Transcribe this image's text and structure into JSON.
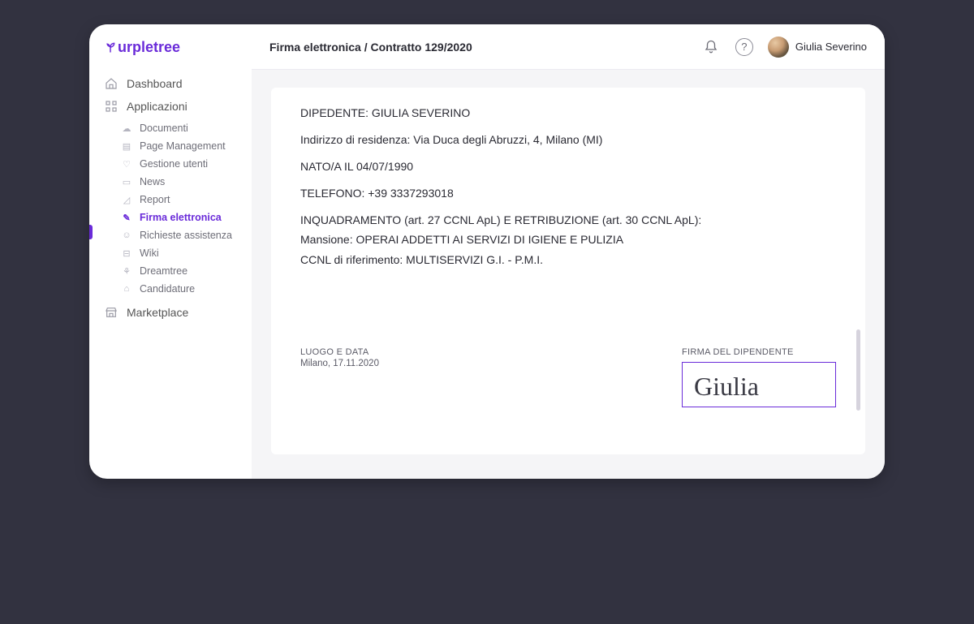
{
  "brand": {
    "name": "urpletree"
  },
  "header": {
    "breadcrumb": "Firma elettronica / Contratto 129/2020",
    "user_name": "Giulia Severino"
  },
  "sidebar": {
    "primary": [
      {
        "label": "Dashboard"
      },
      {
        "label": "Applicazioni"
      },
      {
        "label": "Marketplace"
      }
    ],
    "secondary": [
      {
        "label": "Documenti"
      },
      {
        "label": "Page Management"
      },
      {
        "label": "Gestione utenti"
      },
      {
        "label": "News"
      },
      {
        "label": "Report"
      },
      {
        "label": "Firma elettronica",
        "active": true
      },
      {
        "label": "Richieste assistenza"
      },
      {
        "label": "Wiki"
      },
      {
        "label": "Dreamtree"
      },
      {
        "label": "Candidature"
      }
    ]
  },
  "document": {
    "lines": {
      "l0": "DIPEDENTE: GIULIA SEVERINO",
      "l1": "Indirizzo di residenza: Via Duca degli Abruzzi, 4, Milano (MI)",
      "l2": "NATO/A IL 04/07/1990",
      "l3": "TELEFONO: +39 3337293018",
      "l4": "INQUADRAMENTO (art. 27 CCNL ApL) E RETRIBUZIONE (art. 30 CCNL ApL):",
      "l5": "Mansione: OPERAI ADDETTI AI SERVIZI DI IGIENE E PULIZIA",
      "l6": "CCNL di riferimento: MULTISERVIZI G.I. - P.M.I."
    },
    "footer": {
      "place_date_label": "LUOGO E DATA",
      "place_date_value": "Milano, 17.11.2020",
      "signature_label": "FIRMA DEL DIPENDENTE",
      "signature_value": "Giulia"
    }
  }
}
